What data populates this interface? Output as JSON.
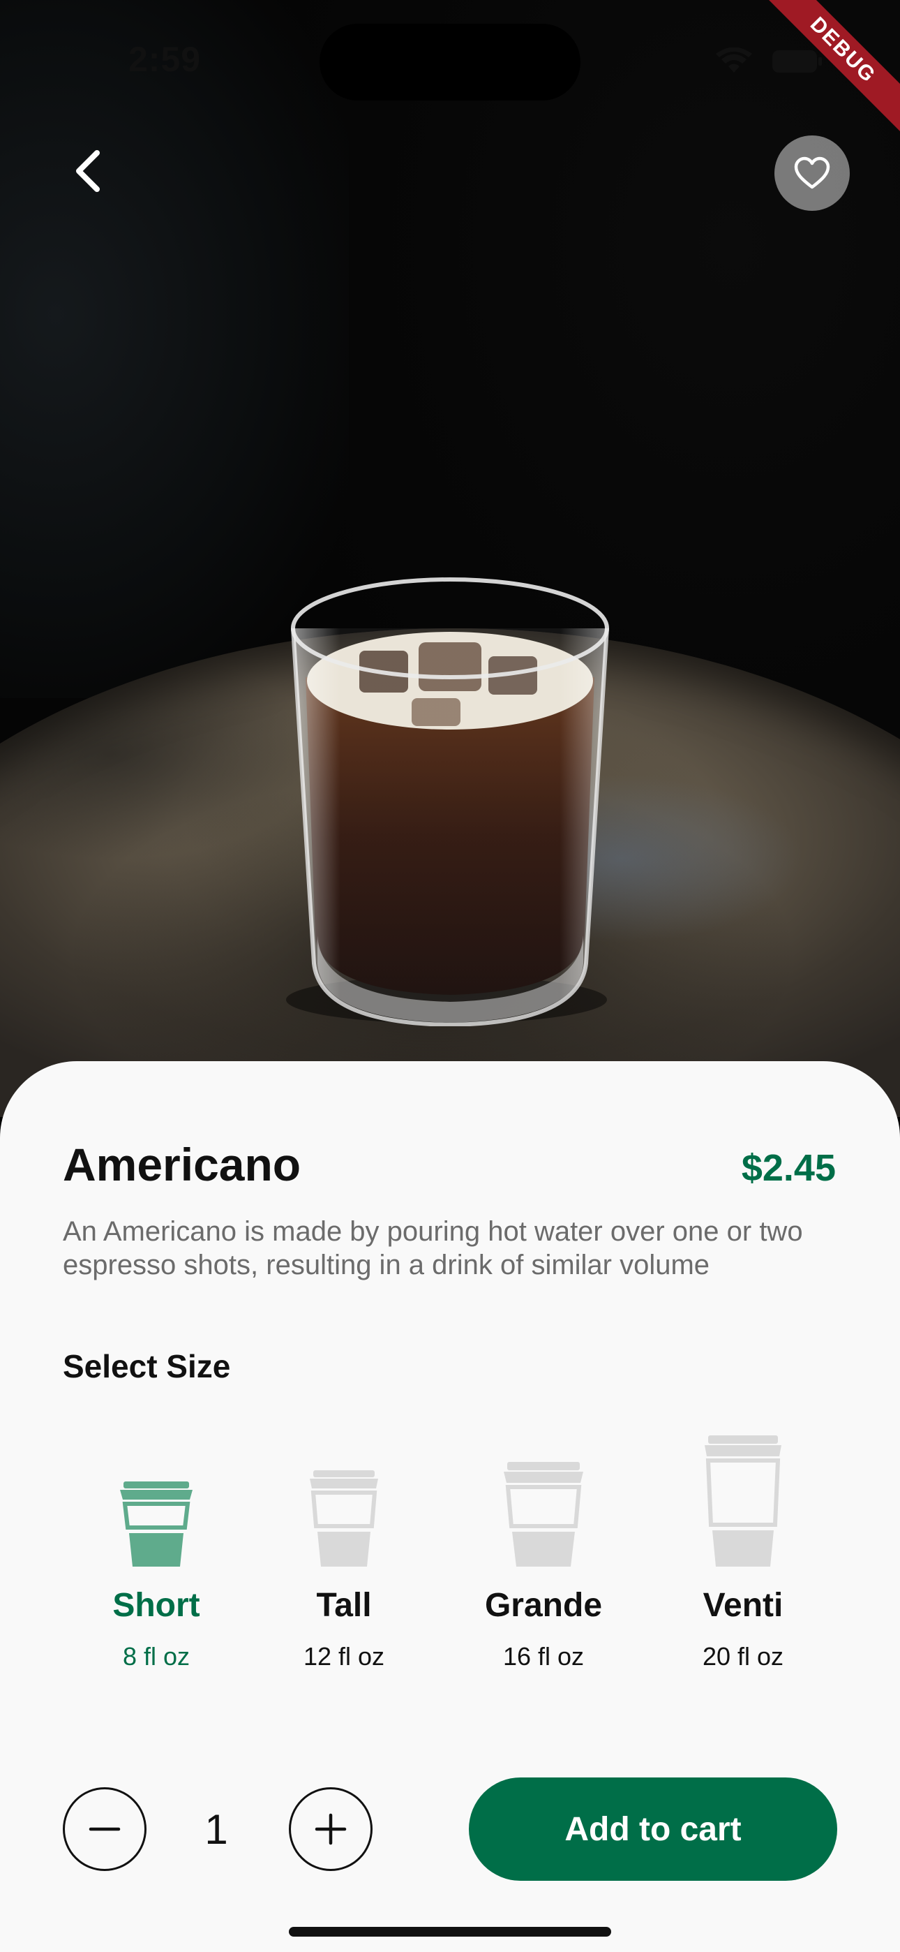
{
  "status_bar": {
    "time": "2:59",
    "icons": [
      "wifi-icon",
      "battery-icon"
    ]
  },
  "debug_banner": {
    "label": "DEBUG"
  },
  "header": {
    "back_icon": "chevron-left-icon",
    "favorite_icon": "heart-outline-icon"
  },
  "product": {
    "name": "Americano",
    "price": "$2.45",
    "description": "An Americano is made by pouring hot water over one or two espresso shots, resulting in a drink of similar volume"
  },
  "size_section": {
    "title": "Select Size",
    "selected": "Short",
    "options": [
      {
        "name": "Short",
        "volume": "8 fl oz"
      },
      {
        "name": "Tall",
        "volume": "12 fl oz"
      },
      {
        "name": "Grande",
        "volume": "16 fl oz"
      },
      {
        "name": "Venti",
        "volume": "20 fl oz"
      }
    ]
  },
  "quantity": {
    "value": "1",
    "decrement_icon": "minus-icon",
    "increment_icon": "plus-icon"
  },
  "cart": {
    "button_label": "Add to cart"
  },
  "colors": {
    "brand_green": "#006e48",
    "selected_cup": "#5fab8c",
    "unselected_cup": "#d9d9d9",
    "sheet_background": "#f9f9f9"
  }
}
